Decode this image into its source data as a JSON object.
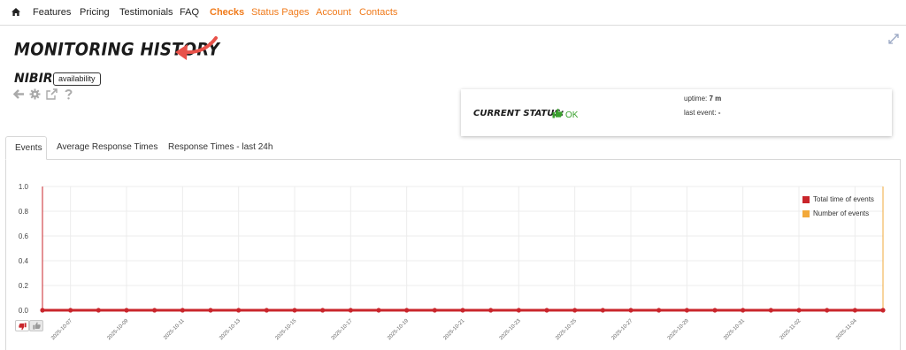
{
  "nav": {
    "items": [
      {
        "label": "Features",
        "style": "dark"
      },
      {
        "label": "Pricing",
        "style": "dark"
      },
      {
        "label": "Testimonials",
        "style": "dark"
      },
      {
        "label": "FAQ",
        "style": "dark"
      },
      {
        "label": "Checks",
        "style": "active"
      },
      {
        "label": "Status Pages",
        "style": "orange"
      },
      {
        "label": "Account",
        "style": "orange"
      },
      {
        "label": "Contacts",
        "style": "orange"
      }
    ],
    "home_icon": "home-icon"
  },
  "header": {
    "title": "Monitoring History",
    "arrow_icon": "curved-arrow-icon",
    "expand_icon": "expand-arrows-icon"
  },
  "check": {
    "name": "NIBIR",
    "tag": "availability",
    "tools": [
      "back-arrow-icon",
      "gear-icon",
      "external-link-icon",
      "help-icon"
    ]
  },
  "status": {
    "label": "Current Status:",
    "value": "OK",
    "uptime_label": "uptime:",
    "uptime_value": "7 m",
    "last_event_label": "last event:",
    "last_event_value": "-"
  },
  "tabs": [
    {
      "label": "Events",
      "active": true
    },
    {
      "label": "Average Response Times",
      "active": false
    },
    {
      "label": "Response Times - last 24h",
      "active": false
    }
  ],
  "colors": {
    "accent": "#f07a1a",
    "ok_green": "#3aa12e",
    "series_total": "#c9252b",
    "series_count": "#f2a93b",
    "title_arrow": "#e8524a"
  },
  "chart_data": {
    "type": "line",
    "y_ticks": [
      "0.0",
      "0.2",
      "0.4",
      "0.6",
      "0.8",
      "1.0"
    ],
    "ylim": [
      0,
      1
    ],
    "x_ticks": [
      "2025-10-07",
      "2025-10-09",
      "2025-10-11",
      "2025-10-13",
      "2025-10-15",
      "2025-10-17",
      "2025-10-19",
      "2025-10-21",
      "2025-10-23",
      "2025-10-25",
      "2025-10-27",
      "2025-10-29",
      "2025-10-31",
      "2025-11-02",
      "2025-11-04"
    ],
    "x": [
      "2025-10-06",
      "2025-10-07",
      "2025-10-08",
      "2025-10-09",
      "2025-10-10",
      "2025-10-11",
      "2025-10-12",
      "2025-10-13",
      "2025-10-14",
      "2025-10-15",
      "2025-10-16",
      "2025-10-17",
      "2025-10-18",
      "2025-10-19",
      "2025-10-20",
      "2025-10-21",
      "2025-10-22",
      "2025-10-23",
      "2025-10-24",
      "2025-10-25",
      "2025-10-26",
      "2025-10-27",
      "2025-10-28",
      "2025-10-29",
      "2025-10-30",
      "2025-10-31",
      "2025-11-01",
      "2025-11-02",
      "2025-11-03",
      "2025-11-04",
      "2025-11-05"
    ],
    "series": [
      {
        "name": "Total time of events",
        "color": "#c9252b",
        "values": [
          0,
          0,
          0,
          0,
          0,
          0,
          0,
          0,
          0,
          0,
          0,
          0,
          0,
          0,
          0,
          0,
          0,
          0,
          0,
          0,
          0,
          0,
          0,
          0,
          0,
          0,
          0,
          0,
          0,
          0,
          0
        ]
      },
      {
        "name": "Number of events",
        "color": "#f2a93b",
        "values": [
          0,
          0,
          0,
          0,
          0,
          0,
          0,
          0,
          0,
          0,
          0,
          0,
          0,
          0,
          0,
          0,
          0,
          0,
          0,
          0,
          0,
          0,
          0,
          0,
          0,
          0,
          0,
          0,
          0,
          0,
          0
        ]
      }
    ],
    "legend": "top-right",
    "grid": true
  },
  "votes": {
    "down_icon": "thumbs-down-icon",
    "up_icon": "thumbs-up-icon"
  }
}
